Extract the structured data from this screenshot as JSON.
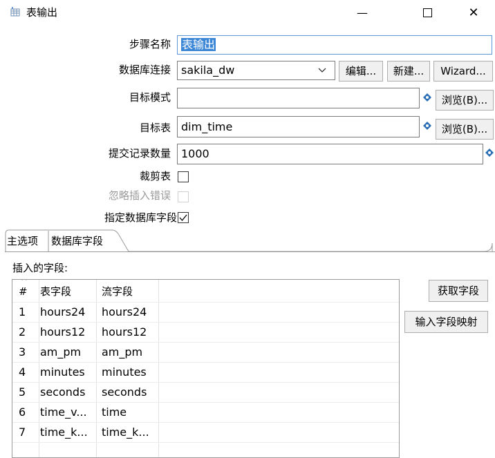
{
  "window": {
    "title": "表输出",
    "minimize_glyph": "—",
    "close_glyph": "✕"
  },
  "form": {
    "step_name_label": "步骤名称",
    "step_name_value": "表输出",
    "connection_label": "数据库连接",
    "connection_value": "sakila_dw",
    "edit_button": "编辑...",
    "new_button": "新建...",
    "wizard_button": "Wizard...",
    "schema_label": "目标模式",
    "schema_value": "",
    "browse_schema_button": "浏览(B)...",
    "table_label": "目标表",
    "table_value": "dim_time",
    "browse_table_button": "浏览(B)...",
    "commit_label": "提交记录数量",
    "commit_value": "1000",
    "truncate_label": "裁剪表",
    "truncate_checked": false,
    "ignore_errors_label": "忽略插入错误",
    "ignore_errors_checked": false,
    "specify_fields_label": "指定数据库字段",
    "specify_fields_checked": true
  },
  "tabs": [
    {
      "label": "主选项",
      "active": false
    },
    {
      "label": "数据库字段",
      "active": true
    }
  ],
  "fields_panel": {
    "title": "插入的字段:",
    "columns": [
      "#",
      "表字段",
      "流字段"
    ],
    "sort_glyph": "^",
    "rows": [
      {
        "num": "1",
        "table_field": "hours24",
        "stream_field": "hours24"
      },
      {
        "num": "2",
        "table_field": "hours12",
        "stream_field": "hours12"
      },
      {
        "num": "3",
        "table_field": "am_pm",
        "stream_field": "am_pm"
      },
      {
        "num": "4",
        "table_field": "minutes",
        "stream_field": "minutes"
      },
      {
        "num": "5",
        "table_field": "seconds",
        "stream_field": "seconds"
      },
      {
        "num": "6",
        "table_field": "time_v...",
        "stream_field": "time"
      },
      {
        "num": "7",
        "table_field": "time_k...",
        "stream_field": "time_k..."
      }
    ],
    "get_fields_button": "获取字段",
    "map_fields_button": "输入字段映射"
  }
}
